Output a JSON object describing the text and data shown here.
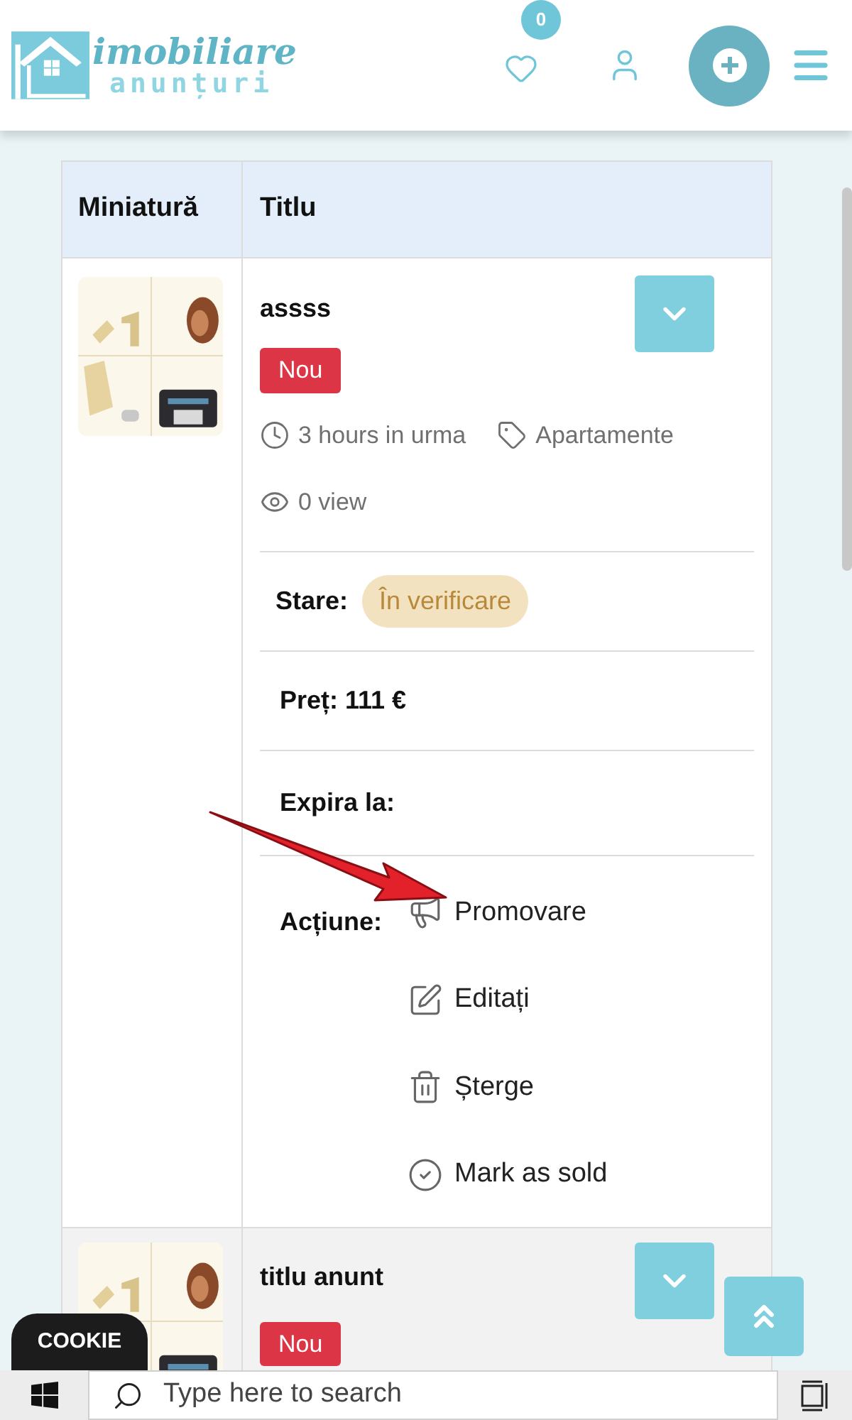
{
  "header": {
    "logo_line_1": "imobiliare",
    "logo_line_2": "anunțuri",
    "favorites_count": "0"
  },
  "table": {
    "columns": [
      "Miniatură",
      "Titlu"
    ],
    "rows": [
      {
        "kind": "expanded",
        "title": "assss",
        "badge": "Nou",
        "time": "3 hours in urma",
        "category": "Apartamente",
        "views": "0 view",
        "status_label": "Stare:",
        "status": "În verificare",
        "price": "Preț: 111 €",
        "expiry_label": "Expira la:",
        "actions_label": "Acțiune:",
        "actions": [
          {
            "kind": "promote",
            "label": "Promovare"
          },
          {
            "kind": "edit",
            "label": "Editați"
          },
          {
            "kind": "delete",
            "label": "Șterge"
          },
          {
            "kind": "sold",
            "label": "Mark as sold"
          }
        ]
      },
      {
        "kind": "collapsed",
        "title": "titlu anunt",
        "badge": "Nou"
      }
    ]
  },
  "cookie_button": "COOKIE",
  "taskbar": {
    "search_placeholder": "Type here to search"
  }
}
